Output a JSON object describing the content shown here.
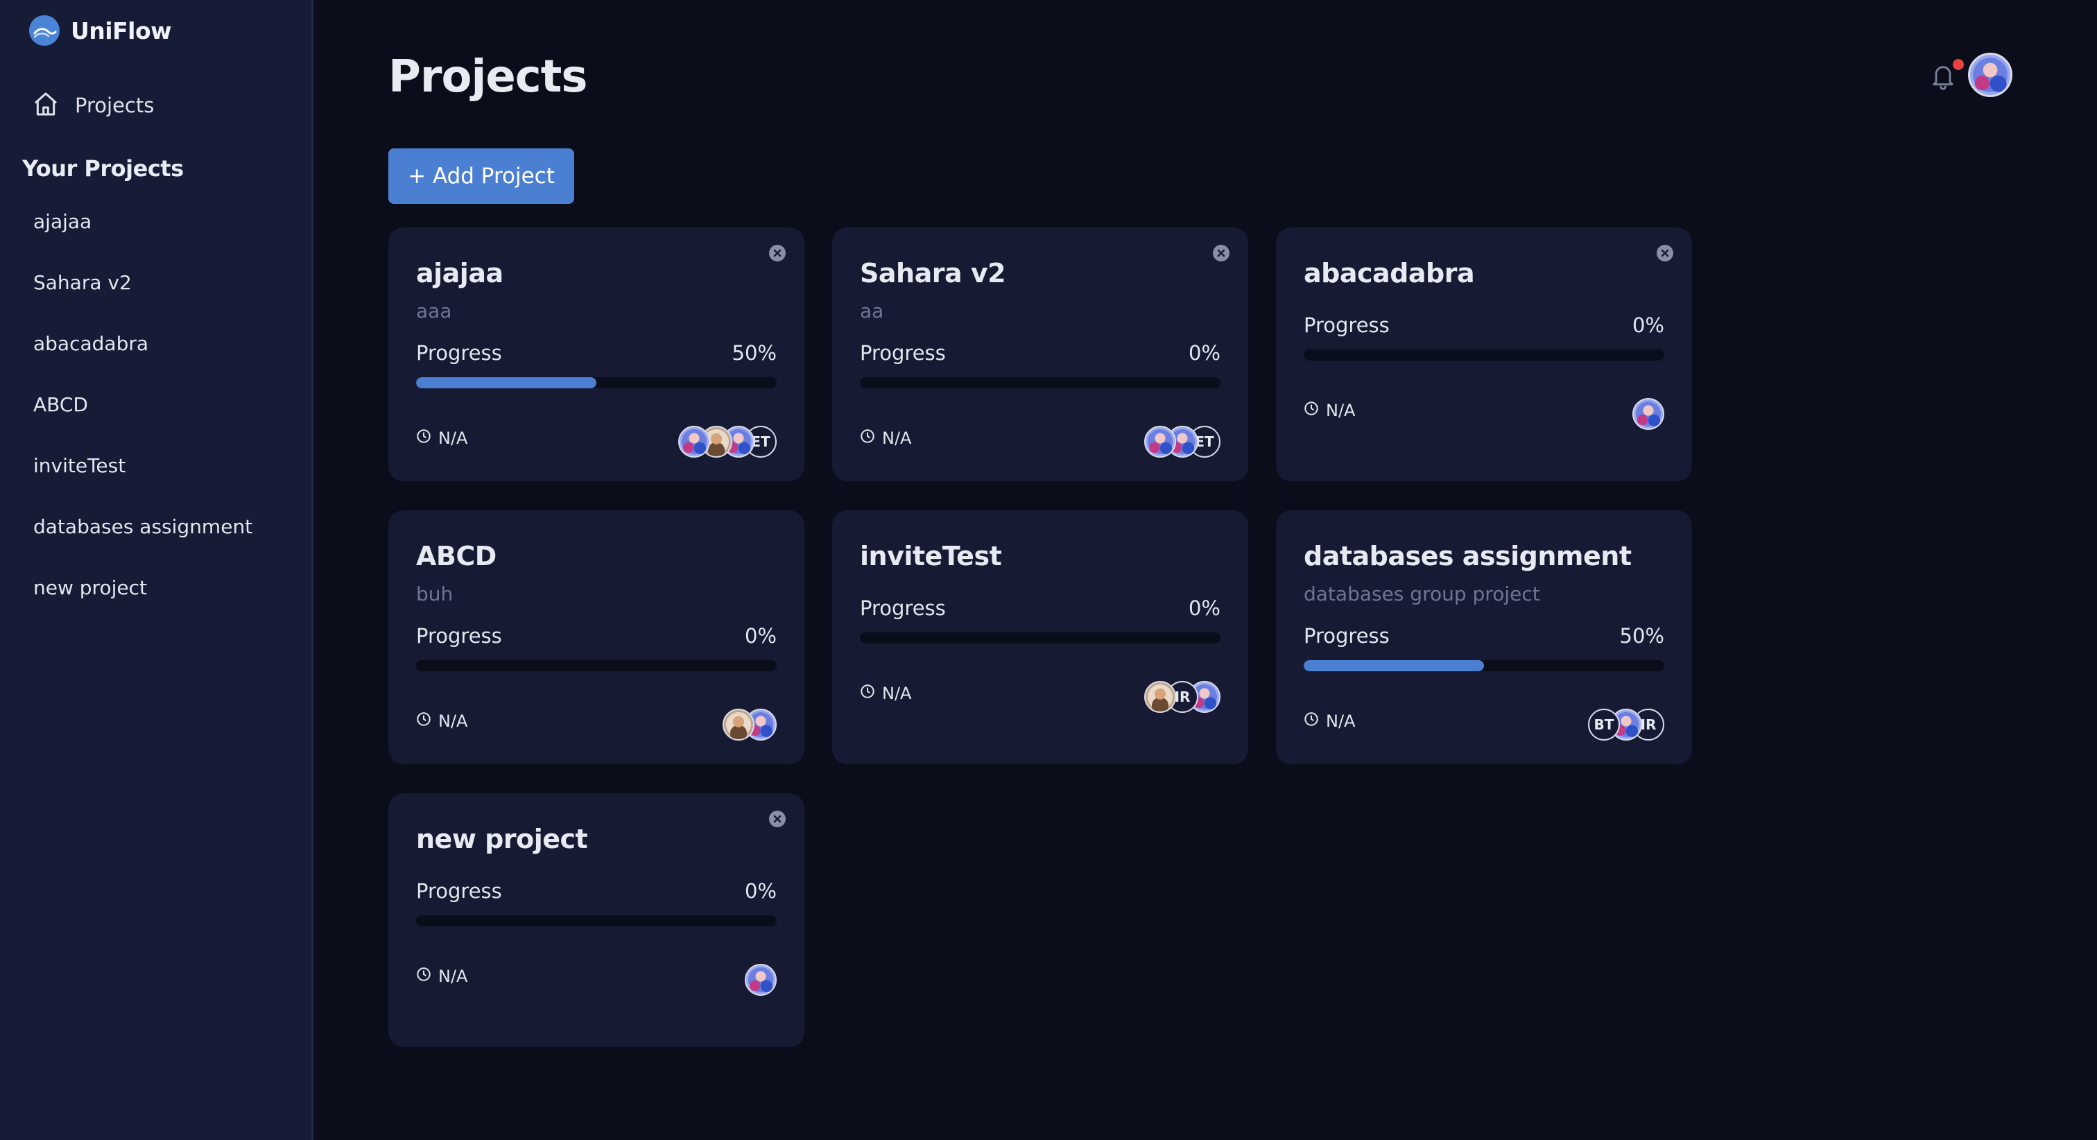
{
  "app": {
    "name": "UniFlow"
  },
  "sidebar": {
    "nav_projects": "Projects",
    "section_title": "Your Projects",
    "items": [
      "ajajaa",
      "Sahara v2",
      "abacadabra",
      "ABCD",
      "inviteTest",
      "databases assignment",
      "new project"
    ]
  },
  "header": {
    "title": "Projects",
    "notifications_unread": true
  },
  "toolbar": {
    "add_label": "+ Add Project"
  },
  "colors": {
    "accent": "#4b7fd1",
    "background": "#0b0e1a",
    "sidebar": "#161c36",
    "card": "#161b33",
    "notification_dot": "#e8413e"
  },
  "progress_label": "Progress",
  "projects": [
    {
      "title": "ajajaa",
      "description": "aaa",
      "progress_text": "50%",
      "progress": 50,
      "due": "N/A",
      "closable": true,
      "members": [
        {
          "type": "photo"
        },
        {
          "type": "photo2"
        },
        {
          "type": "photo"
        },
        {
          "type": "initials",
          "text": "ET"
        }
      ]
    },
    {
      "title": "Sahara v2",
      "description": "aa",
      "progress_text": "0%",
      "progress": 0,
      "due": "N/A",
      "closable": true,
      "members": [
        {
          "type": "photo"
        },
        {
          "type": "photo"
        },
        {
          "type": "initials",
          "text": "ET"
        }
      ]
    },
    {
      "title": "abacadabra",
      "description": "",
      "progress_text": "0%",
      "progress": 0,
      "due": "N/A",
      "closable": true,
      "members": [
        {
          "type": "photo"
        }
      ]
    },
    {
      "title": "ABCD",
      "description": "buh",
      "progress_text": "0%",
      "progress": 0,
      "due": "N/A",
      "closable": false,
      "members": [
        {
          "type": "photo2"
        },
        {
          "type": "photo"
        }
      ]
    },
    {
      "title": "inviteTest",
      "description": "",
      "progress_text": "0%",
      "progress": 0,
      "due": "N/A",
      "closable": false,
      "members": [
        {
          "type": "photo2"
        },
        {
          "type": "initials",
          "text": "IR"
        },
        {
          "type": "photo"
        }
      ]
    },
    {
      "title": "databases assignment",
      "description": "databases group project",
      "progress_text": "50%",
      "progress": 50,
      "due": "N/A",
      "closable": false,
      "members": [
        {
          "type": "initials",
          "text": "BT"
        },
        {
          "type": "photo"
        },
        {
          "type": "initials",
          "text": "IR"
        }
      ]
    },
    {
      "title": "new project",
      "description": "",
      "progress_text": "0%",
      "progress": 0,
      "due": "N/A",
      "closable": true,
      "members": [
        {
          "type": "photo"
        }
      ]
    }
  ]
}
